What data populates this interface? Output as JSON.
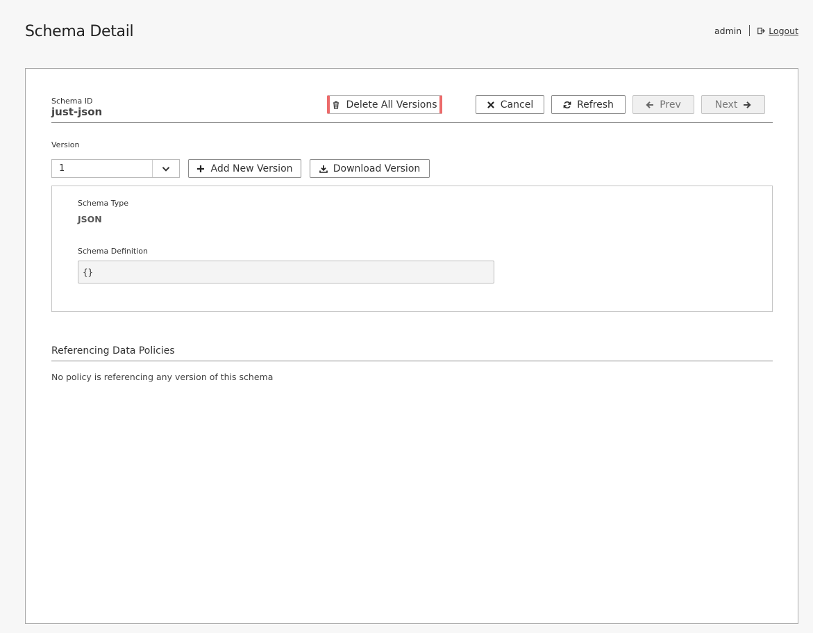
{
  "page": {
    "title": "Schema Detail"
  },
  "user": {
    "name": "admin",
    "logout_label": "Logout"
  },
  "schema": {
    "id_label": "Schema ID",
    "id_value": "just-json"
  },
  "toolbar": {
    "delete_all_label": "Delete All Versions",
    "cancel_label": "Cancel",
    "refresh_label": "Refresh",
    "prev_label": "Prev",
    "next_label": "Next"
  },
  "version": {
    "label": "Version",
    "selected": "1",
    "add_label": "Add New Version",
    "download_label": "Download Version"
  },
  "details": {
    "type_label": "Schema Type",
    "type_value": "JSON",
    "definition_label": "Schema Definition",
    "definition_value": "{}"
  },
  "references": {
    "title": "Referencing Data Policies",
    "empty_message": "No policy is referencing any version of this schema"
  },
  "colors": {
    "danger_accent": "#ec6a6a",
    "panel_border": "#a9a9a9",
    "background": "#f7f7f7"
  }
}
